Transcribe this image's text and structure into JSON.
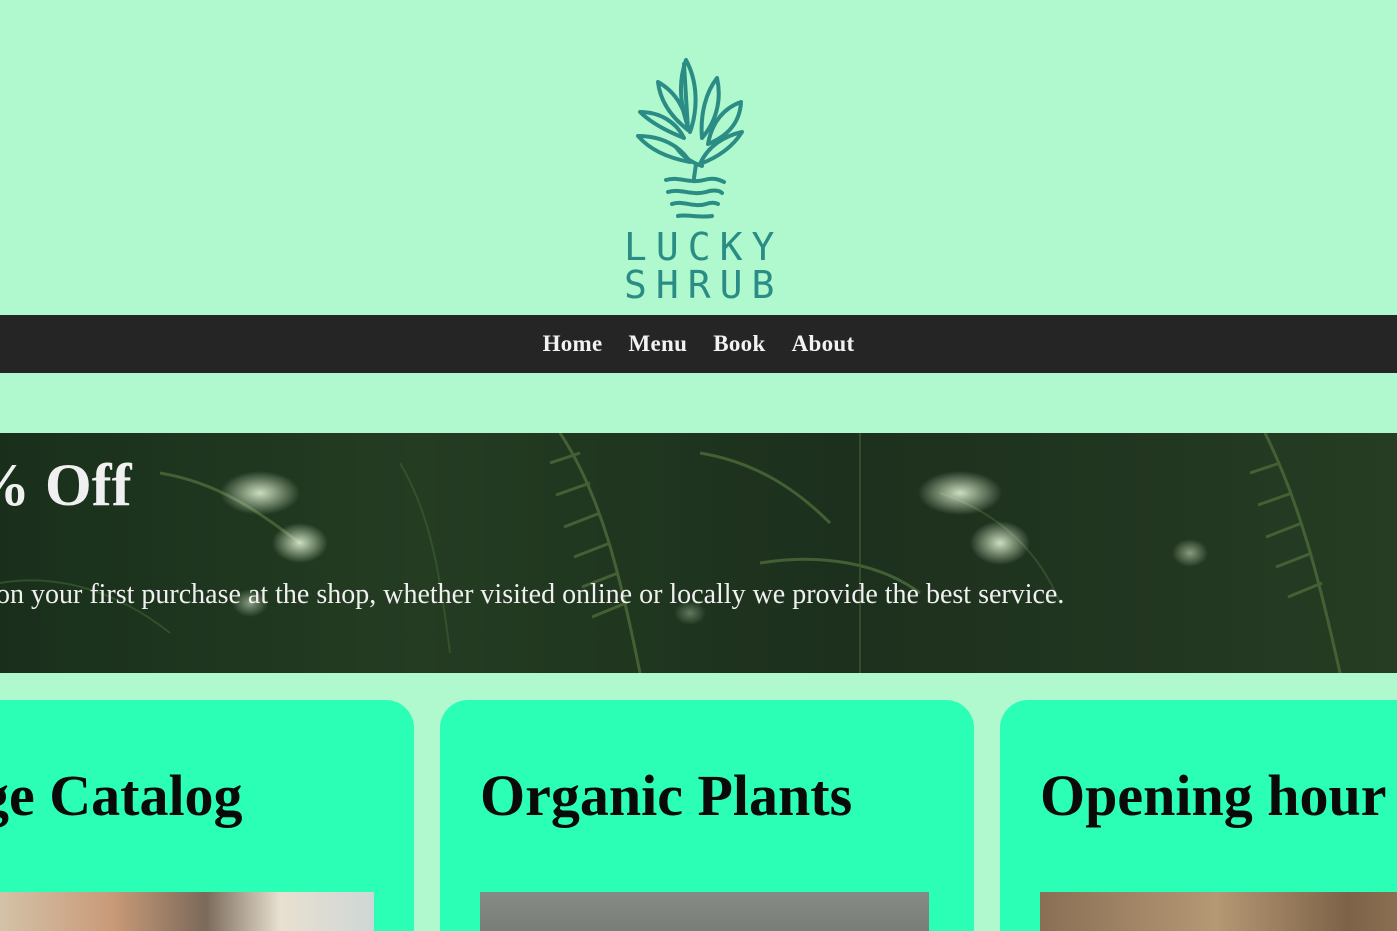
{
  "brand": {
    "line1": "LUCKY",
    "line2": "SHRUB",
    "logo_icon": "potted-plant-icon",
    "logo_color": "#2a8c84"
  },
  "nav": {
    "items": [
      {
        "label": "Home"
      },
      {
        "label": "Menu"
      },
      {
        "label": "Book"
      },
      {
        "label": "About"
      }
    ]
  },
  "hero": {
    "title": "% Off",
    "text": "on your first purchase at the shop, whether visited online or locally we provide the best service."
  },
  "cards": [
    {
      "title": "ge Catalog"
    },
    {
      "title": "Organic Plants"
    },
    {
      "title": "Opening hour"
    }
  ],
  "colors": {
    "page_bg": "#b0f8cd",
    "nav_bg": "#252525",
    "card_bg": "#2bffb5"
  }
}
